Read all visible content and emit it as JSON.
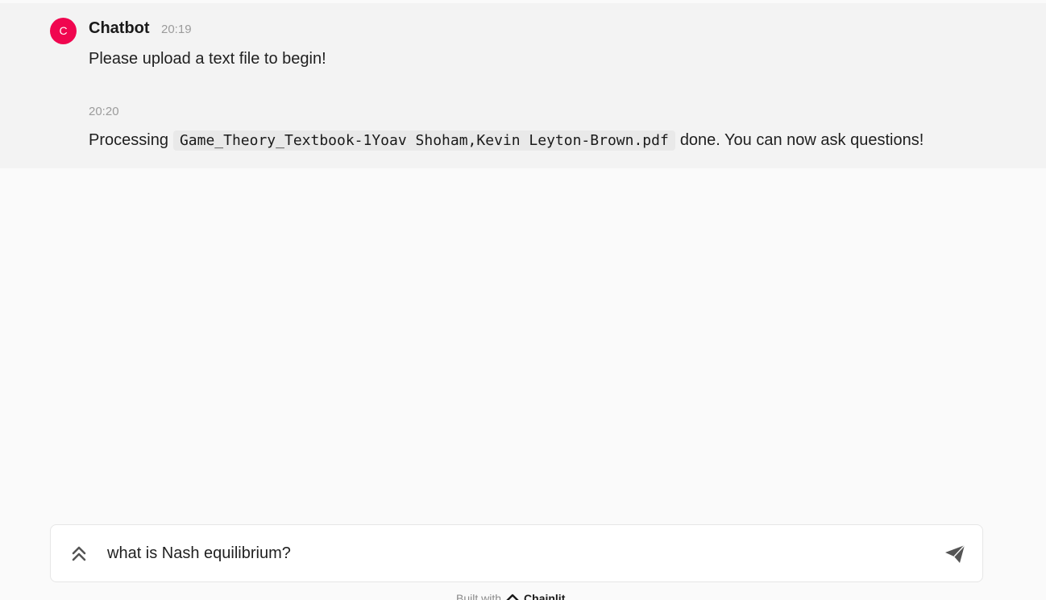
{
  "messages": [
    {
      "author": "Chatbot",
      "avatar_letter": "C",
      "avatar_color": "#f0064f",
      "time": "20:19",
      "text": "Please upload a text file to begin!"
    },
    {
      "time": "20:20",
      "prefix": "Processing",
      "code": "Game_Theory_Textbook-1Yoav Shoham,Kevin Leyton-Brown.pdf",
      "suffix": "done. You can now ask questions!"
    }
  ],
  "composer": {
    "value": "what is Nash equilibrium?",
    "settings_icon": "chevrons-up-icon",
    "send_icon": "send-icon"
  },
  "footer": {
    "text": "Built with",
    "brand": "Chainlit",
    "brand_icon": "chainlit-logo-icon"
  }
}
